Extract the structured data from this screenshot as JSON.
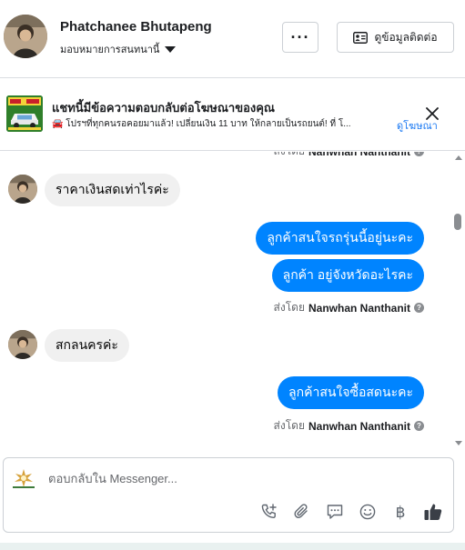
{
  "header": {
    "contact_name": "Phatchanee Bhutapeng",
    "assign_label": "มอบหมายการสนทนานี้",
    "more_label": "···",
    "contact_info_label": "ดูข้อมูลติดต่อ"
  },
  "ad": {
    "title": "แชทนี้มีข้อความตอบกลับต่อโฆษณาของคุณ",
    "subtitle": "🚘 โปรฯที่ทุกคนรอคอยมาแล้ว! เปลี่ยนเงิน 11 บาท ให้กลายเป็นรถยนต์! ที่ โ...",
    "view_ad_label": "ดูโฆษณา"
  },
  "chat": {
    "sent_by_prefix": "ส่งโดย",
    "agent_name": "Nanwhan Nanthanit",
    "messages": [
      {
        "direction": "in",
        "text": "ราคาเงินสดเท่าไรค่ะ"
      },
      {
        "direction": "out",
        "text": "ลูกค้าสนใจรถรุ่นนี้อยู่นะคะ"
      },
      {
        "direction": "out",
        "text": "ลูกค้า  อยู่จังหวัดอะไรคะ"
      },
      {
        "direction": "in",
        "text": "สกลนครค่ะ"
      },
      {
        "direction": "out",
        "text": "ลูกค้าสนใจซื้อสดนะคะ"
      }
    ]
  },
  "composer": {
    "placeholder": "ตอบกลับใน Messenger...",
    "baht_symbol": "฿",
    "tools": [
      "call-add-icon",
      "attachment-icon",
      "saved-reply-icon",
      "emoji-icon",
      "baht-icon",
      "thumbs-up-icon"
    ]
  },
  "colors": {
    "accent": "#0084ff",
    "link": "#1877f2",
    "incoming_bubble": "#f0f0f0",
    "muted_text": "#65676b"
  }
}
